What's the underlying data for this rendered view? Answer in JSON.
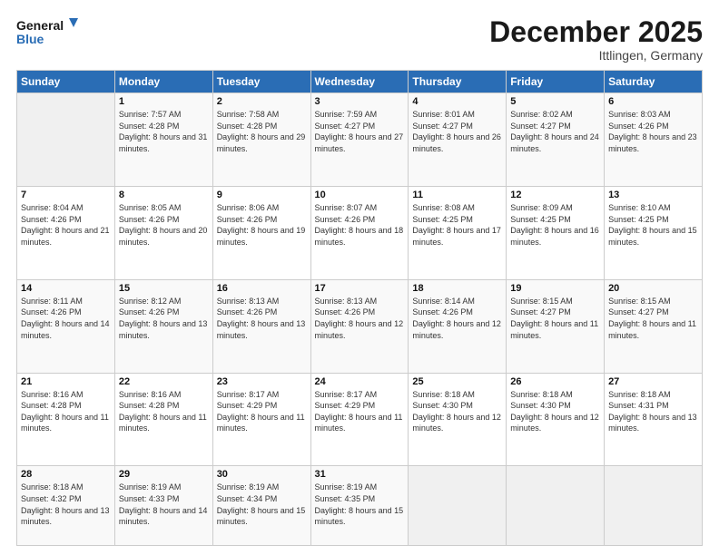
{
  "logo": {
    "line1": "General",
    "line2": "Blue"
  },
  "title": "December 2025",
  "location": "Ittlingen, Germany",
  "days_of_week": [
    "Sunday",
    "Monday",
    "Tuesday",
    "Wednesday",
    "Thursday",
    "Friday",
    "Saturday"
  ],
  "weeks": [
    [
      {
        "num": "",
        "sunrise": "",
        "sunset": "",
        "daylight": ""
      },
      {
        "num": "1",
        "sunrise": "Sunrise: 7:57 AM",
        "sunset": "Sunset: 4:28 PM",
        "daylight": "Daylight: 8 hours and 31 minutes."
      },
      {
        "num": "2",
        "sunrise": "Sunrise: 7:58 AM",
        "sunset": "Sunset: 4:28 PM",
        "daylight": "Daylight: 8 hours and 29 minutes."
      },
      {
        "num": "3",
        "sunrise": "Sunrise: 7:59 AM",
        "sunset": "Sunset: 4:27 PM",
        "daylight": "Daylight: 8 hours and 27 minutes."
      },
      {
        "num": "4",
        "sunrise": "Sunrise: 8:01 AM",
        "sunset": "Sunset: 4:27 PM",
        "daylight": "Daylight: 8 hours and 26 minutes."
      },
      {
        "num": "5",
        "sunrise": "Sunrise: 8:02 AM",
        "sunset": "Sunset: 4:27 PM",
        "daylight": "Daylight: 8 hours and 24 minutes."
      },
      {
        "num": "6",
        "sunrise": "Sunrise: 8:03 AM",
        "sunset": "Sunset: 4:26 PM",
        "daylight": "Daylight: 8 hours and 23 minutes."
      }
    ],
    [
      {
        "num": "7",
        "sunrise": "Sunrise: 8:04 AM",
        "sunset": "Sunset: 4:26 PM",
        "daylight": "Daylight: 8 hours and 21 minutes."
      },
      {
        "num": "8",
        "sunrise": "Sunrise: 8:05 AM",
        "sunset": "Sunset: 4:26 PM",
        "daylight": "Daylight: 8 hours and 20 minutes."
      },
      {
        "num": "9",
        "sunrise": "Sunrise: 8:06 AM",
        "sunset": "Sunset: 4:26 PM",
        "daylight": "Daylight: 8 hours and 19 minutes."
      },
      {
        "num": "10",
        "sunrise": "Sunrise: 8:07 AM",
        "sunset": "Sunset: 4:26 PM",
        "daylight": "Daylight: 8 hours and 18 minutes."
      },
      {
        "num": "11",
        "sunrise": "Sunrise: 8:08 AM",
        "sunset": "Sunset: 4:25 PM",
        "daylight": "Daylight: 8 hours and 17 minutes."
      },
      {
        "num": "12",
        "sunrise": "Sunrise: 8:09 AM",
        "sunset": "Sunset: 4:25 PM",
        "daylight": "Daylight: 8 hours and 16 minutes."
      },
      {
        "num": "13",
        "sunrise": "Sunrise: 8:10 AM",
        "sunset": "Sunset: 4:25 PM",
        "daylight": "Daylight: 8 hours and 15 minutes."
      }
    ],
    [
      {
        "num": "14",
        "sunrise": "Sunrise: 8:11 AM",
        "sunset": "Sunset: 4:26 PM",
        "daylight": "Daylight: 8 hours and 14 minutes."
      },
      {
        "num": "15",
        "sunrise": "Sunrise: 8:12 AM",
        "sunset": "Sunset: 4:26 PM",
        "daylight": "Daylight: 8 hours and 13 minutes."
      },
      {
        "num": "16",
        "sunrise": "Sunrise: 8:13 AM",
        "sunset": "Sunset: 4:26 PM",
        "daylight": "Daylight: 8 hours and 13 minutes."
      },
      {
        "num": "17",
        "sunrise": "Sunrise: 8:13 AM",
        "sunset": "Sunset: 4:26 PM",
        "daylight": "Daylight: 8 hours and 12 minutes."
      },
      {
        "num": "18",
        "sunrise": "Sunrise: 8:14 AM",
        "sunset": "Sunset: 4:26 PM",
        "daylight": "Daylight: 8 hours and 12 minutes."
      },
      {
        "num": "19",
        "sunrise": "Sunrise: 8:15 AM",
        "sunset": "Sunset: 4:27 PM",
        "daylight": "Daylight: 8 hours and 11 minutes."
      },
      {
        "num": "20",
        "sunrise": "Sunrise: 8:15 AM",
        "sunset": "Sunset: 4:27 PM",
        "daylight": "Daylight: 8 hours and 11 minutes."
      }
    ],
    [
      {
        "num": "21",
        "sunrise": "Sunrise: 8:16 AM",
        "sunset": "Sunset: 4:28 PM",
        "daylight": "Daylight: 8 hours and 11 minutes."
      },
      {
        "num": "22",
        "sunrise": "Sunrise: 8:16 AM",
        "sunset": "Sunset: 4:28 PM",
        "daylight": "Daylight: 8 hours and 11 minutes."
      },
      {
        "num": "23",
        "sunrise": "Sunrise: 8:17 AM",
        "sunset": "Sunset: 4:29 PM",
        "daylight": "Daylight: 8 hours and 11 minutes."
      },
      {
        "num": "24",
        "sunrise": "Sunrise: 8:17 AM",
        "sunset": "Sunset: 4:29 PM",
        "daylight": "Daylight: 8 hours and 11 minutes."
      },
      {
        "num": "25",
        "sunrise": "Sunrise: 8:18 AM",
        "sunset": "Sunset: 4:30 PM",
        "daylight": "Daylight: 8 hours and 12 minutes."
      },
      {
        "num": "26",
        "sunrise": "Sunrise: 8:18 AM",
        "sunset": "Sunset: 4:30 PM",
        "daylight": "Daylight: 8 hours and 12 minutes."
      },
      {
        "num": "27",
        "sunrise": "Sunrise: 8:18 AM",
        "sunset": "Sunset: 4:31 PM",
        "daylight": "Daylight: 8 hours and 13 minutes."
      }
    ],
    [
      {
        "num": "28",
        "sunrise": "Sunrise: 8:18 AM",
        "sunset": "Sunset: 4:32 PM",
        "daylight": "Daylight: 8 hours and 13 minutes."
      },
      {
        "num": "29",
        "sunrise": "Sunrise: 8:19 AM",
        "sunset": "Sunset: 4:33 PM",
        "daylight": "Daylight: 8 hours and 14 minutes."
      },
      {
        "num": "30",
        "sunrise": "Sunrise: 8:19 AM",
        "sunset": "Sunset: 4:34 PM",
        "daylight": "Daylight: 8 hours and 15 minutes."
      },
      {
        "num": "31",
        "sunrise": "Sunrise: 8:19 AM",
        "sunset": "Sunset: 4:35 PM",
        "daylight": "Daylight: 8 hours and 15 minutes."
      },
      {
        "num": "",
        "sunrise": "",
        "sunset": "",
        "daylight": ""
      },
      {
        "num": "",
        "sunrise": "",
        "sunset": "",
        "daylight": ""
      },
      {
        "num": "",
        "sunrise": "",
        "sunset": "",
        "daylight": ""
      }
    ]
  ]
}
